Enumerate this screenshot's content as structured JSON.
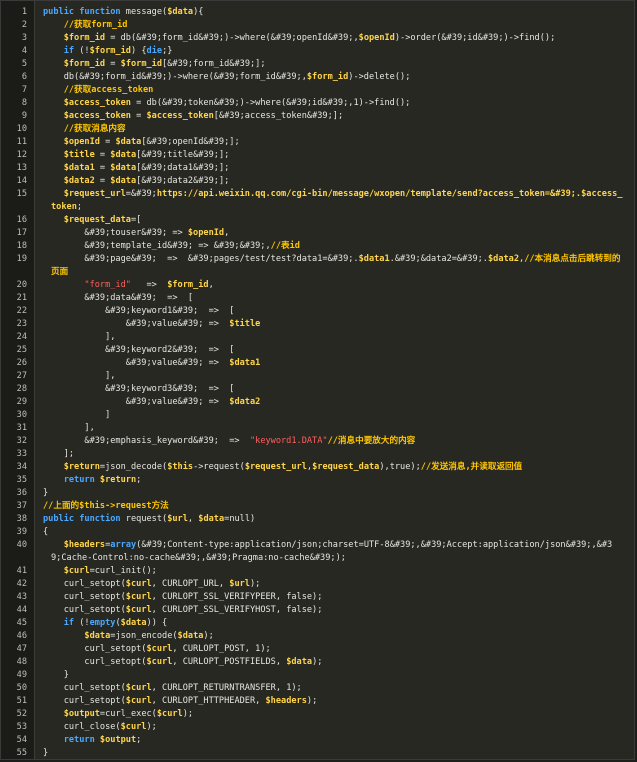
{
  "lines": [
    {
      "n": "1",
      "t": [
        [
          "kw",
          "public function "
        ],
        [
          "fn",
          "message("
        ],
        [
          "var",
          "$data"
        ],
        [
          "fn",
          "){"
        ]
      ]
    },
    {
      "n": "2",
      "t": [
        [
          "fn",
          "    "
        ],
        [
          "cm",
          "//获取form_id"
        ]
      ]
    },
    {
      "n": "3",
      "t": [
        [
          "fn",
          "    "
        ],
        [
          "var",
          "$form_id"
        ],
        [
          "fn",
          " = db(&#39;form_id&#39;)->where(&#39;openId&#39;,"
        ],
        [
          "var",
          "$openId"
        ],
        [
          "fn",
          ")->order(&#39;id&#39;)->find();"
        ]
      ]
    },
    {
      "n": "4",
      "t": [
        [
          "fn",
          "    "
        ],
        [
          "kw",
          "if "
        ],
        [
          "fn",
          "(!"
        ],
        [
          "var",
          "$form_id"
        ],
        [
          "fn",
          ") {"
        ],
        [
          "kw",
          "die"
        ],
        [
          "fn",
          ";}"
        ]
      ]
    },
    {
      "n": "5",
      "t": [
        [
          "fn",
          "    "
        ],
        [
          "var",
          "$form_id"
        ],
        [
          "fn",
          " = "
        ],
        [
          "var",
          "$form_id"
        ],
        [
          "fn",
          "[&#39;form_id&#39;];"
        ]
      ]
    },
    {
      "n": "6",
      "t": [
        [
          "fn",
          "    db(&#39;form_id&#39;)->where(&#39;form_id&#39;,"
        ],
        [
          "var",
          "$form_id"
        ],
        [
          "fn",
          ")->delete();"
        ]
      ]
    },
    {
      "n": "7",
      "t": [
        [
          "fn",
          "    "
        ],
        [
          "cm",
          "//获取access_token"
        ]
      ]
    },
    {
      "n": "8",
      "t": [
        [
          "fn",
          "    "
        ],
        [
          "var",
          "$access_token"
        ],
        [
          "fn",
          " = db(&#39;token&#39;)->where(&#39;id&#39;,1)->find();"
        ]
      ]
    },
    {
      "n": "9",
      "t": [
        [
          "fn",
          "    "
        ],
        [
          "var",
          "$access_token"
        ],
        [
          "fn",
          " = "
        ],
        [
          "var",
          "$access_token"
        ],
        [
          "fn",
          "[&#39;access_token&#39;];"
        ]
      ]
    },
    {
      "n": "10",
      "t": [
        [
          "fn",
          "    "
        ],
        [
          "cm",
          "//获取消息内容"
        ]
      ]
    },
    {
      "n": "11",
      "t": [
        [
          "fn",
          "    "
        ],
        [
          "var",
          "$openId"
        ],
        [
          "fn",
          " = "
        ],
        [
          "var",
          "$data"
        ],
        [
          "fn",
          "[&#39;openId&#39;];"
        ]
      ]
    },
    {
      "n": "12",
      "t": [
        [
          "fn",
          "    "
        ],
        [
          "var",
          "$title"
        ],
        [
          "fn",
          " = "
        ],
        [
          "var",
          "$data"
        ],
        [
          "fn",
          "[&#39;title&#39;];"
        ]
      ]
    },
    {
      "n": "13",
      "t": [
        [
          "fn",
          "    "
        ],
        [
          "var",
          "$data1"
        ],
        [
          "fn",
          " = "
        ],
        [
          "var",
          "$data"
        ],
        [
          "fn",
          "[&#39;data1&#39;];"
        ]
      ]
    },
    {
      "n": "14",
      "t": [
        [
          "fn",
          "    "
        ],
        [
          "var",
          "$data2"
        ],
        [
          "fn",
          " = "
        ],
        [
          "var",
          "$data"
        ],
        [
          "fn",
          "[&#39;data2&#39;];"
        ]
      ]
    },
    {
      "n": "15",
      "t": [
        [
          "fn",
          "    "
        ],
        [
          "var",
          "$request_url"
        ],
        [
          "fn",
          "=&#39;"
        ],
        [
          "var",
          "https://api.weixin.qq.com/cgi-bin/message/wxopen/template/send?access_token=&#39;.$access_"
        ]
      ]
    },
    {
      "n": "",
      "cont": true,
      "t": [
        [
          "var",
          "token"
        ],
        [
          "fn",
          ";"
        ]
      ]
    },
    {
      "n": "16",
      "t": [
        [
          "fn",
          "    "
        ],
        [
          "var",
          "$request_data"
        ],
        [
          "fn",
          "=["
        ]
      ]
    },
    {
      "n": "17",
      "t": [
        [
          "fn",
          "        &#39;touser&#39; => "
        ],
        [
          "var",
          "$openId"
        ],
        [
          "fn",
          ","
        ]
      ]
    },
    {
      "n": "18",
      "t": [
        [
          "fn",
          "        &#39;template_id&#39; => &#39;&#39;,"
        ],
        [
          "cm",
          "//表id"
        ]
      ]
    },
    {
      "n": "19",
      "t": [
        [
          "fn",
          "        &#39;page&#39;  =>  &#39;pages/test/test?data1=&#39;."
        ],
        [
          "var",
          "$data1"
        ],
        [
          "fn",
          ".&#39;&data2=&#39;."
        ],
        [
          "var",
          "$data2"
        ],
        [
          "fn",
          ","
        ],
        [
          "cm",
          "//本消息点击后跳转到的"
        ]
      ]
    },
    {
      "n": "",
      "cont": true,
      "t": [
        [
          "cm",
          "页面"
        ]
      ]
    },
    {
      "n": "20",
      "t": [
        [
          "fn",
          "        "
        ],
        [
          "str",
          "\"form_id\""
        ],
        [
          "fn",
          "   =>  "
        ],
        [
          "var",
          "$form_id"
        ],
        [
          "fn",
          ","
        ]
      ]
    },
    {
      "n": "21",
      "t": [
        [
          "fn",
          "        &#39;data&#39;  =>  ["
        ]
      ]
    },
    {
      "n": "22",
      "t": [
        [
          "fn",
          "            &#39;keyword1&#39;  =>  ["
        ]
      ]
    },
    {
      "n": "23",
      "t": [
        [
          "fn",
          "                &#39;value&#39; =>  "
        ],
        [
          "var",
          "$title"
        ]
      ]
    },
    {
      "n": "24",
      "t": [
        [
          "fn",
          "            ],"
        ]
      ]
    },
    {
      "n": "25",
      "t": [
        [
          "fn",
          "            &#39;keyword2&#39;  =>  ["
        ]
      ]
    },
    {
      "n": "26",
      "t": [
        [
          "fn",
          "                &#39;value&#39; =>  "
        ],
        [
          "var",
          "$data1"
        ]
      ]
    },
    {
      "n": "27",
      "t": [
        [
          "fn",
          "            ],"
        ]
      ]
    },
    {
      "n": "28",
      "t": [
        [
          "fn",
          "            &#39;keyword3&#39;  =>  ["
        ]
      ]
    },
    {
      "n": "29",
      "t": [
        [
          "fn",
          "                &#39;value&#39; =>  "
        ],
        [
          "var",
          "$data2"
        ]
      ]
    },
    {
      "n": "30",
      "t": [
        [
          "fn",
          "            ]"
        ]
      ]
    },
    {
      "n": "31",
      "t": [
        [
          "fn",
          "        ],"
        ]
      ]
    },
    {
      "n": "32",
      "t": [
        [
          "fn",
          "        &#39;emphasis_keyword&#39;  =>  "
        ],
        [
          "str",
          "\"keyword1.DATA\""
        ],
        [
          "cm",
          "//消息中要放大的内容"
        ]
      ]
    },
    {
      "n": "33",
      "t": [
        [
          "fn",
          "    ];"
        ]
      ]
    },
    {
      "n": "34",
      "t": [
        [
          "fn",
          "    "
        ],
        [
          "var",
          "$return"
        ],
        [
          "fn",
          "=json_decode("
        ],
        [
          "var",
          "$this"
        ],
        [
          "fn",
          "->request("
        ],
        [
          "var",
          "$request_url"
        ],
        [
          "fn",
          ","
        ],
        [
          "var",
          "$request_data"
        ],
        [
          "fn",
          "),true);"
        ],
        [
          "cm",
          "//发送消息,并读取返回值"
        ]
      ]
    },
    {
      "n": "35",
      "t": [
        [
          "fn",
          "    "
        ],
        [
          "kw",
          "return "
        ],
        [
          "var",
          "$return"
        ],
        [
          "fn",
          ";"
        ]
      ]
    },
    {
      "n": "36",
      "t": [
        [
          "fn",
          "}"
        ]
      ]
    },
    {
      "n": "37",
      "t": [
        [
          "cm",
          "//上面的$this->request方法"
        ]
      ]
    },
    {
      "n": "38",
      "t": [
        [
          "kw",
          "public function "
        ],
        [
          "fn",
          "request("
        ],
        [
          "var",
          "$url"
        ],
        [
          "fn",
          ", "
        ],
        [
          "var",
          "$data"
        ],
        [
          "fn",
          "=null)"
        ]
      ]
    },
    {
      "n": "39",
      "t": [
        [
          "fn",
          "{"
        ]
      ]
    },
    {
      "n": "40",
      "t": [
        [
          "fn",
          "    "
        ],
        [
          "var",
          "$headers"
        ],
        [
          "fn",
          "="
        ],
        [
          "kw",
          "array"
        ],
        [
          "fn",
          "(&#39;Content-type:application/json;charset=UTF-8&#39;,&#39;Accept:application/json&#39;,&#3"
        ]
      ]
    },
    {
      "n": "",
      "cont": true,
      "t": [
        [
          "fn",
          "9;Cache-Control:no-cache&#39;,&#39;Pragma:no-cache&#39;);"
        ]
      ]
    },
    {
      "n": "41",
      "t": [
        [
          "fn",
          "    "
        ],
        [
          "var",
          "$curl"
        ],
        [
          "fn",
          "=curl_init();"
        ]
      ]
    },
    {
      "n": "42",
      "t": [
        [
          "fn",
          "    curl_setopt("
        ],
        [
          "var",
          "$curl"
        ],
        [
          "fn",
          ", CURLOPT_URL, "
        ],
        [
          "var",
          "$url"
        ],
        [
          "fn",
          ");"
        ]
      ]
    },
    {
      "n": "43",
      "t": [
        [
          "fn",
          "    curl_setopt("
        ],
        [
          "var",
          "$curl"
        ],
        [
          "fn",
          ", CURLOPT_SSL_VERIFYPEER, false);"
        ]
      ]
    },
    {
      "n": "44",
      "t": [
        [
          "fn",
          "    curl_setopt("
        ],
        [
          "var",
          "$curl"
        ],
        [
          "fn",
          ", CURLOPT_SSL_VERIFYHOST, false);"
        ]
      ]
    },
    {
      "n": "45",
      "t": [
        [
          "fn",
          "    "
        ],
        [
          "kw",
          "if "
        ],
        [
          "fn",
          "(!"
        ],
        [
          "kw",
          "empty"
        ],
        [
          "fn",
          "("
        ],
        [
          "var",
          "$data"
        ],
        [
          "fn",
          ")) {"
        ]
      ]
    },
    {
      "n": "46",
      "t": [
        [
          "fn",
          "        "
        ],
        [
          "var",
          "$data"
        ],
        [
          "fn",
          "=json_encode("
        ],
        [
          "var",
          "$data"
        ],
        [
          "fn",
          ");"
        ]
      ]
    },
    {
      "n": "47",
      "t": [
        [
          "fn",
          "        curl_setopt("
        ],
        [
          "var",
          "$curl"
        ],
        [
          "fn",
          ", CURLOPT_POST, 1);"
        ]
      ]
    },
    {
      "n": "48",
      "t": [
        [
          "fn",
          "        curl_setopt("
        ],
        [
          "var",
          "$curl"
        ],
        [
          "fn",
          ", CURLOPT_POSTFIELDS, "
        ],
        [
          "var",
          "$data"
        ],
        [
          "fn",
          ");"
        ]
      ]
    },
    {
      "n": "49",
      "t": [
        [
          "fn",
          "    }"
        ]
      ]
    },
    {
      "n": "50",
      "t": [
        [
          "fn",
          "    curl_setopt("
        ],
        [
          "var",
          "$curl"
        ],
        [
          "fn",
          ", CURLOPT_RETURNTRANSFER, 1);"
        ]
      ]
    },
    {
      "n": "51",
      "t": [
        [
          "fn",
          "    curl_setopt("
        ],
        [
          "var",
          "$curl"
        ],
        [
          "fn",
          ", CURLOPT_HTTPHEADER, "
        ],
        [
          "var",
          "$headers"
        ],
        [
          "fn",
          ");"
        ]
      ]
    },
    {
      "n": "52",
      "t": [
        [
          "fn",
          "    "
        ],
        [
          "var",
          "$output"
        ],
        [
          "fn",
          "=curl_exec("
        ],
        [
          "var",
          "$curl"
        ],
        [
          "fn",
          ");"
        ]
      ]
    },
    {
      "n": "53",
      "t": [
        [
          "fn",
          "    curl_close("
        ],
        [
          "var",
          "$curl"
        ],
        [
          "fn",
          ");"
        ]
      ]
    },
    {
      "n": "54",
      "t": [
        [
          "fn",
          "    "
        ],
        [
          "kw",
          "return "
        ],
        [
          "var",
          "$output"
        ],
        [
          "fn",
          ";"
        ]
      ]
    },
    {
      "n": "55",
      "t": [
        [
          "fn",
          "}"
        ]
      ]
    }
  ]
}
